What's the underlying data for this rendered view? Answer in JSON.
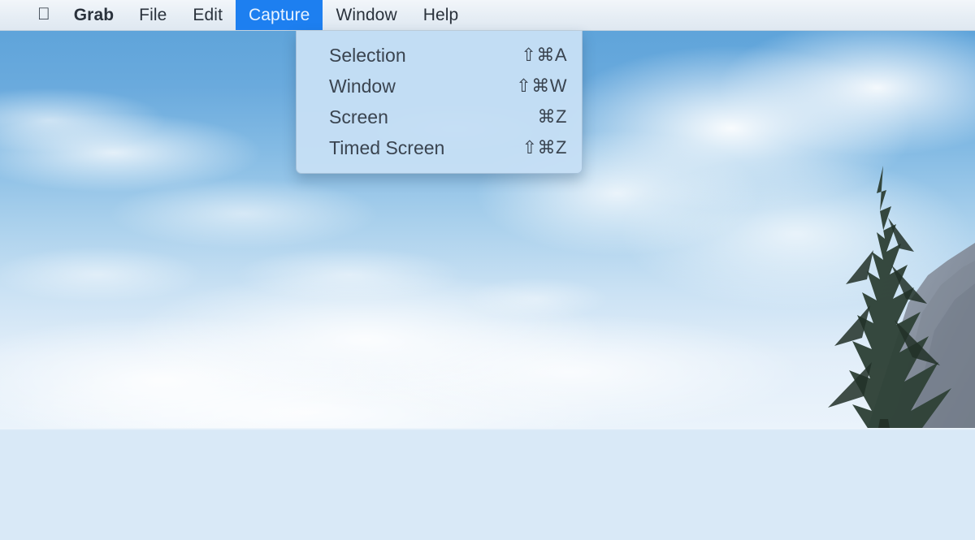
{
  "menubar": {
    "apple_icon": "apple-logo-icon",
    "items": [
      {
        "label": "Grab",
        "bold": true,
        "active": false
      },
      {
        "label": "File",
        "bold": false,
        "active": false
      },
      {
        "label": "Edit",
        "bold": false,
        "active": false
      },
      {
        "label": "Capture",
        "bold": false,
        "active": true
      },
      {
        "label": "Window",
        "bold": false,
        "active": false
      },
      {
        "label": "Help",
        "bold": false,
        "active": false
      }
    ],
    "background_color": "#e7eef5",
    "active_item_color": "#1d7ff0",
    "active_item_text_color": "#e8f3ff",
    "text_color": "#2a323c"
  },
  "capture_menu": {
    "open": true,
    "parent": "Capture",
    "background_color": "#c6dff5",
    "text_color": "#3a4450",
    "items": [
      {
        "label": "Selection",
        "shortcut": "⇧⌘A"
      },
      {
        "label": "Window",
        "shortcut": "⇧⌘W"
      },
      {
        "label": "Screen",
        "shortcut": "⌘Z"
      },
      {
        "label": "Timed Screen",
        "shortcut": "⇧⌘Z"
      }
    ]
  },
  "desktop": {
    "description": "Blue sky with white clouds, conifer tree and rocky mountain at right",
    "sky_color": "#6aaadd",
    "cloud_color": "#ffffff",
    "tree_color": "#2c3f33",
    "mountain_color": "#8d98a6",
    "lower_panel_color": "#d9e9f7"
  }
}
